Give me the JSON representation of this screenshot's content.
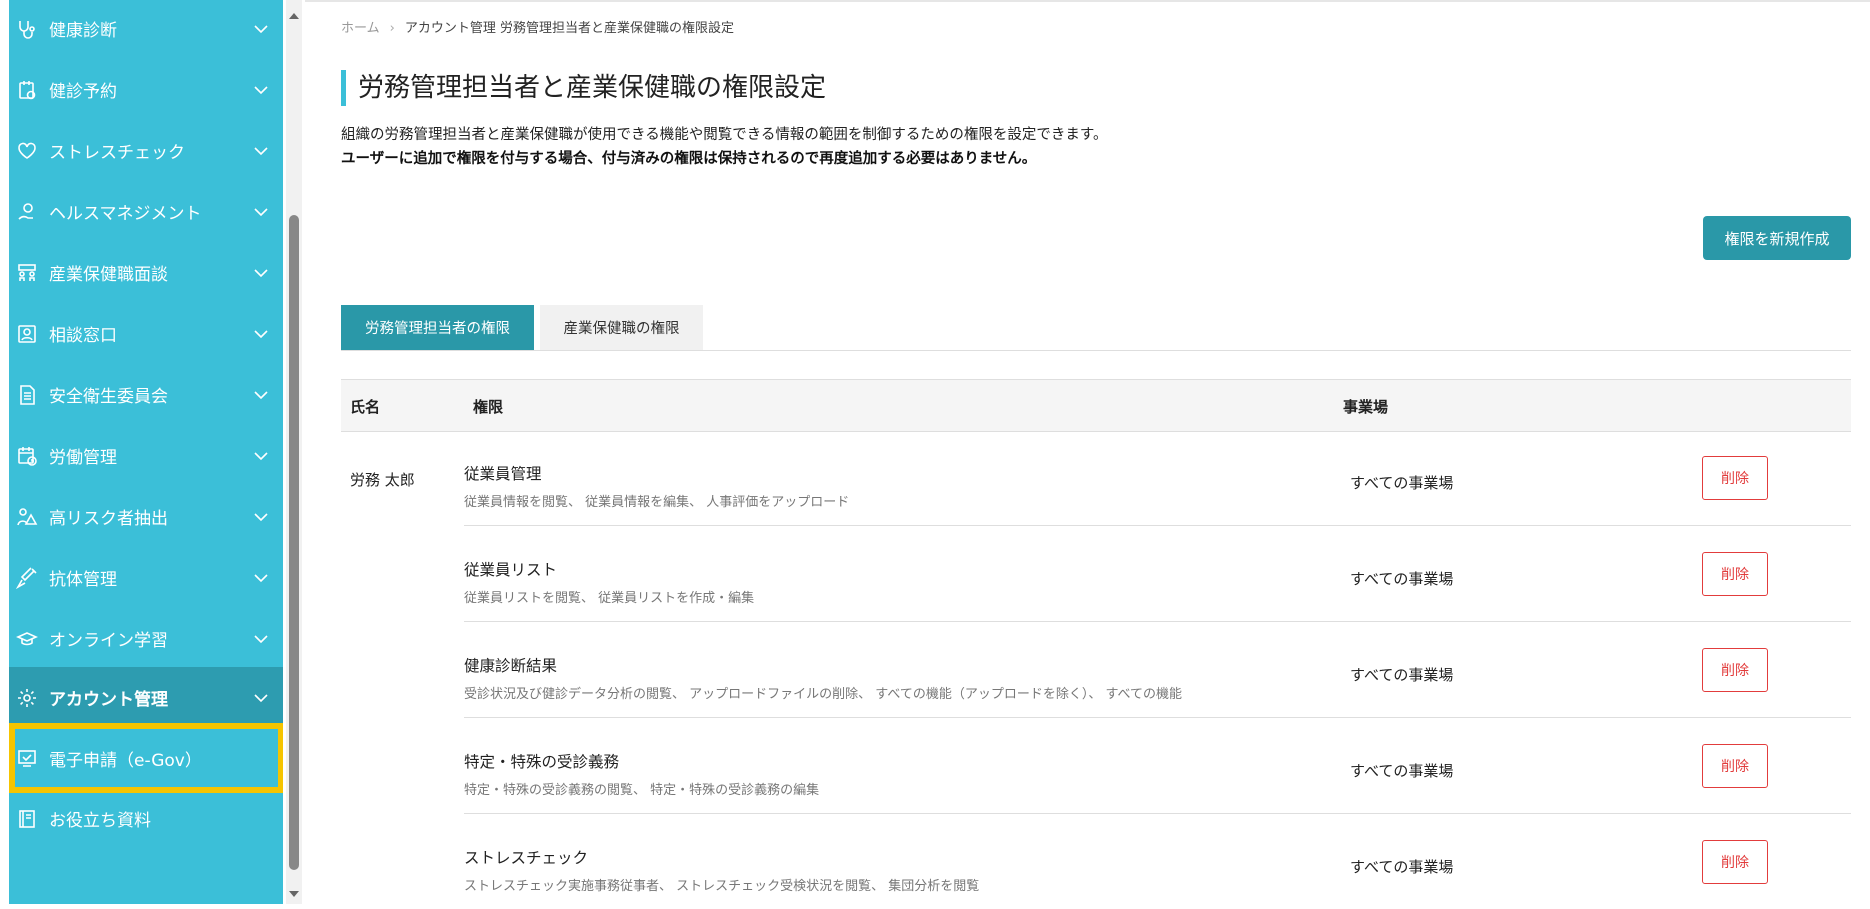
{
  "sidebar": {
    "items": [
      {
        "label": "健康診断",
        "icon": "stethoscope-icon"
      },
      {
        "label": "健診予約",
        "icon": "calendar-clipboard-icon"
      },
      {
        "label": "ストレスチェック",
        "icon": "heart-icon"
      },
      {
        "label": "ヘルスマネジメント",
        "icon": "stethoscope-hand-icon"
      },
      {
        "label": "産業保健職面談",
        "icon": "meeting-icon"
      },
      {
        "label": "相談窓口",
        "icon": "person-card-icon"
      },
      {
        "label": "安全衛生委員会",
        "icon": "document-icon"
      },
      {
        "label": "労働管理",
        "icon": "calendar-clock-icon"
      },
      {
        "label": "高リスク者抽出",
        "icon": "warning-person-icon"
      },
      {
        "label": "抗体管理",
        "icon": "syringe-icon"
      },
      {
        "label": "オンライン学習",
        "icon": "graduation-cap-icon"
      },
      {
        "label": "アカウント管理",
        "icon": "gear-icon"
      },
      {
        "label": "電子申請（e-Gov）",
        "icon": "checked-screen-icon"
      },
      {
        "label": "お役立ち資料",
        "icon": "book-icon"
      }
    ],
    "active_index": 11,
    "highlight_index": 12
  },
  "breadcrumb": {
    "home": "ホーム",
    "separator": "›",
    "current": "アカウント管理 労務管理担当者と産業保健職の権限設定"
  },
  "page": {
    "title": "労務管理担当者と産業保健職の権限設定",
    "description": "組織の労務管理担当者と産業保健職が使用できる機能や閲覧できる情報の範囲を制御するための権限を設定できます。",
    "note": "ユーザーに追加で権限を付与する場合、付与済みの権限は保持されるので再度追加する必要はありません。",
    "create_button": "権限を新規作成"
  },
  "tabs": [
    {
      "label": "労務管理担当者の権限",
      "active": true
    },
    {
      "label": "産業保健職の権限",
      "active": false
    }
  ],
  "table": {
    "headers": {
      "name": "氏名",
      "permission": "権限",
      "site": "事業場"
    },
    "person": "労務 太郎",
    "rows": [
      {
        "permission": "従業員管理",
        "detail": "従業員情報を閲覧、 従業員情報を編集、 人事評価をアップロード",
        "site": "すべての事業場",
        "action": "削除"
      },
      {
        "permission": "従業員リスト",
        "detail": "従業員リストを閲覧、 従業員リストを作成・編集",
        "site": "すべての事業場",
        "action": "削除"
      },
      {
        "permission": "健康診断結果",
        "detail": "受診状況及び健診データ分析の閲覧、 アップロードファイルの削除、 すべての機能（アップロードを除く）、 すべての機能",
        "site": "すべての事業場",
        "action": "削除"
      },
      {
        "permission": "特定・特殊の受診義務",
        "detail": "特定・特殊の受診義務の閲覧、 特定・特殊の受診義務の編集",
        "site": "すべての事業場",
        "action": "削除"
      },
      {
        "permission": "ストレスチェック",
        "detail": "ストレスチェック実施事務従事者、 ストレスチェック受検状況を閲覧、 集団分析を閲覧",
        "site": "すべての事業場",
        "action": "削除"
      }
    ]
  },
  "colors": {
    "sidebar_bg": "#3bbfd8",
    "sidebar_active_bg": "#2d9cb0",
    "highlight_border": "#f5c400",
    "primary_button": "#2a98a8",
    "delete_red": "#e23c3c"
  }
}
